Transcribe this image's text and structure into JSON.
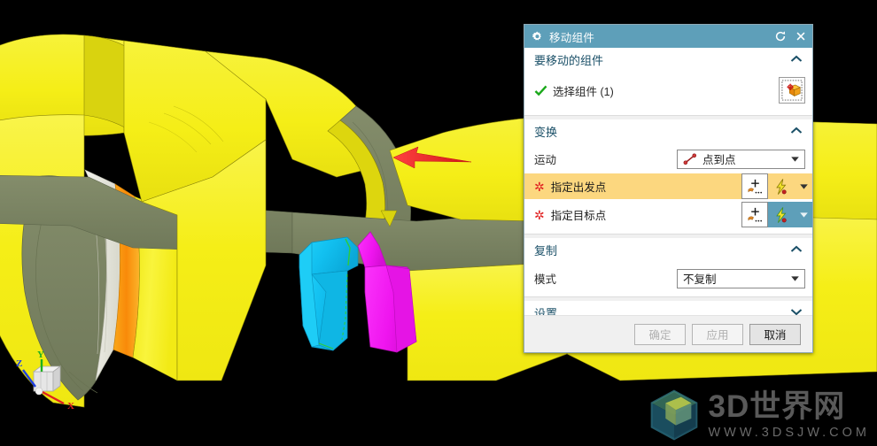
{
  "app": {
    "scene_description": "NX assembly cutaway view: yellow cylindrical housing sections with olive-green section-cut faces, a cyan bracket component, a magenta ring component, an orange inner band, and a red direction arrow annotation",
    "background_color": "#000000",
    "part_colors": {
      "body_yellow": "#f5ee17",
      "section_olive": "#7b8464",
      "component_cyan": "#12c6f5",
      "component_magenta": "#f31ef3",
      "band_orange": "#f79a10",
      "inner_white": "#e8e8e0",
      "arrow_red": "#f03434"
    }
  },
  "triad": {
    "x_label": "X",
    "y_label": "Y",
    "z_label": "Z",
    "x_color": "#e02020",
    "y_color": "#20b020",
    "z_color": "#2040e0"
  },
  "dialog": {
    "title": "移动组件",
    "icons": {
      "gear": "gear-icon",
      "reset": "reset-icon",
      "close": "close-icon"
    },
    "sections": [
      {
        "id": "components",
        "title": "要移动的组件",
        "collapsed": false,
        "chevron": "chevron-up-icon",
        "select_label": "选择组件 (1)",
        "select_icon": "select-component-cube-icon",
        "check_icon": "green-check-icon"
      },
      {
        "id": "transform",
        "title": "变换",
        "collapsed": false,
        "chevron": "chevron-up-icon",
        "motion_label": "运动",
        "motion_value": "点到点",
        "motion_icon": "point-to-point-icon",
        "points": [
          {
            "label": "指定出发点",
            "state": "active",
            "required": true,
            "point_ctor_icon": "point-constructor-icon",
            "snap_icon": "point-snap-icon",
            "dropdown_icon": "chevron-down-icon"
          },
          {
            "label": "指定目标点",
            "state": "idle",
            "required": true,
            "point_ctor_icon": "point-constructor-icon",
            "snap_icon": "point-snap-icon",
            "dropdown_icon": "chevron-down-icon"
          }
        ]
      },
      {
        "id": "copy",
        "title": "复制",
        "collapsed": false,
        "chevron": "chevron-up-icon",
        "mode_label": "模式",
        "mode_value": "不复制"
      },
      {
        "id": "settings",
        "title": "设置",
        "collapsed": true,
        "chevron": "chevron-down-icon"
      }
    ],
    "footer": {
      "ok_label": "确定",
      "ok_enabled": false,
      "apply_label": "应用",
      "apply_enabled": false,
      "cancel_label": "取消",
      "cancel_enabled": true
    },
    "colors": {
      "titlebar": "#5e9fb9",
      "section_title": "#1b5068",
      "active_row": "#fcd77f",
      "teal_button": "#5e9fb9",
      "asterisk": "#e02020"
    }
  },
  "watermark": {
    "main": "3D世界网",
    "sub": "WWW.3DSJW.COM",
    "logo": "cube-logo-icon"
  }
}
